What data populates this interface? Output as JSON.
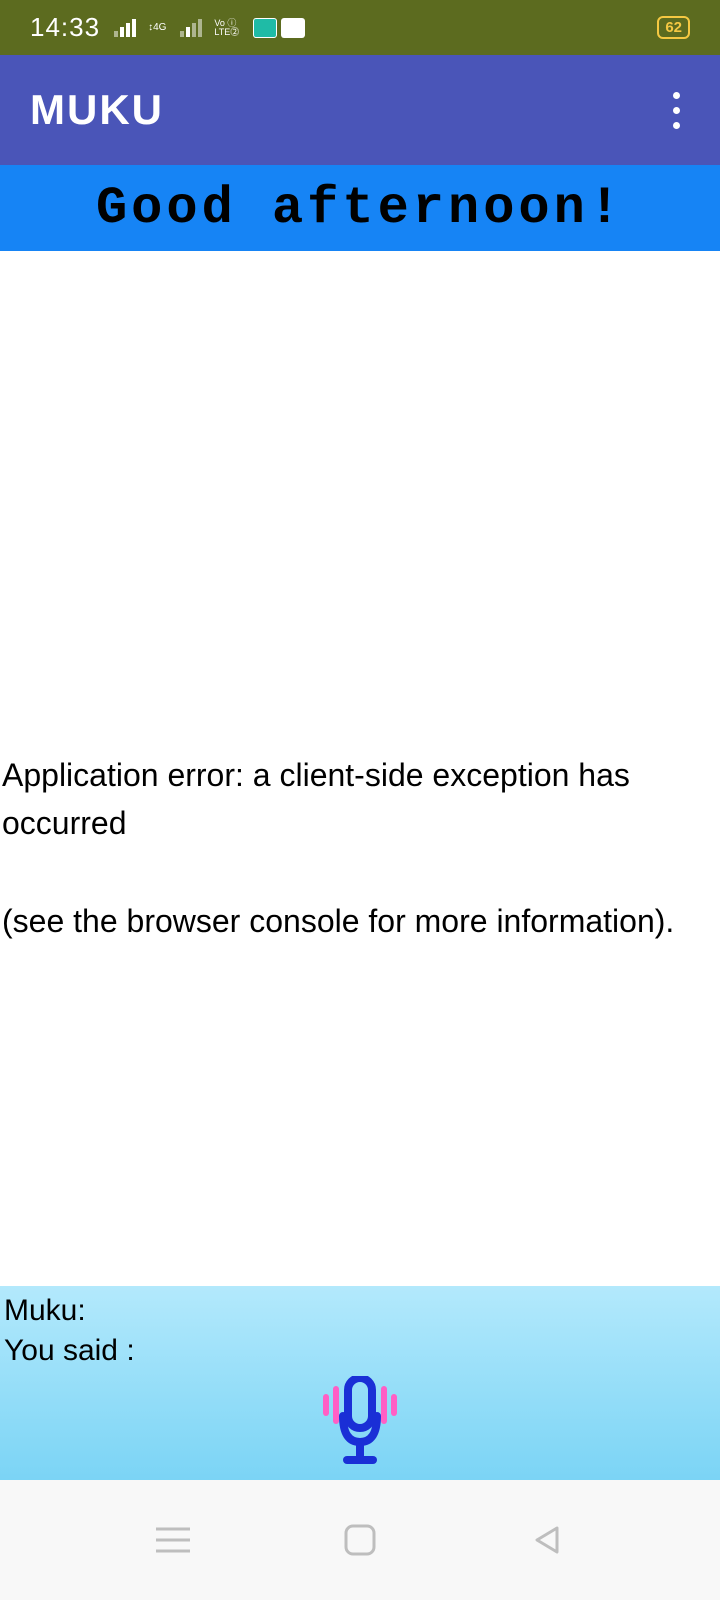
{
  "statusBar": {
    "time": "14:33",
    "network4g": "4G",
    "volte": "Vo LTE",
    "battery": "62"
  },
  "appBar": {
    "title": "MUKU"
  },
  "greeting": {
    "text": "Good afternoon!"
  },
  "error": {
    "line1": "Application error: a client-side exception has occurred",
    "line2": "(see the browser console for more information)."
  },
  "bottomPanel": {
    "mukuLabel": "Muku:",
    "youSaidLabel": "You said :"
  }
}
